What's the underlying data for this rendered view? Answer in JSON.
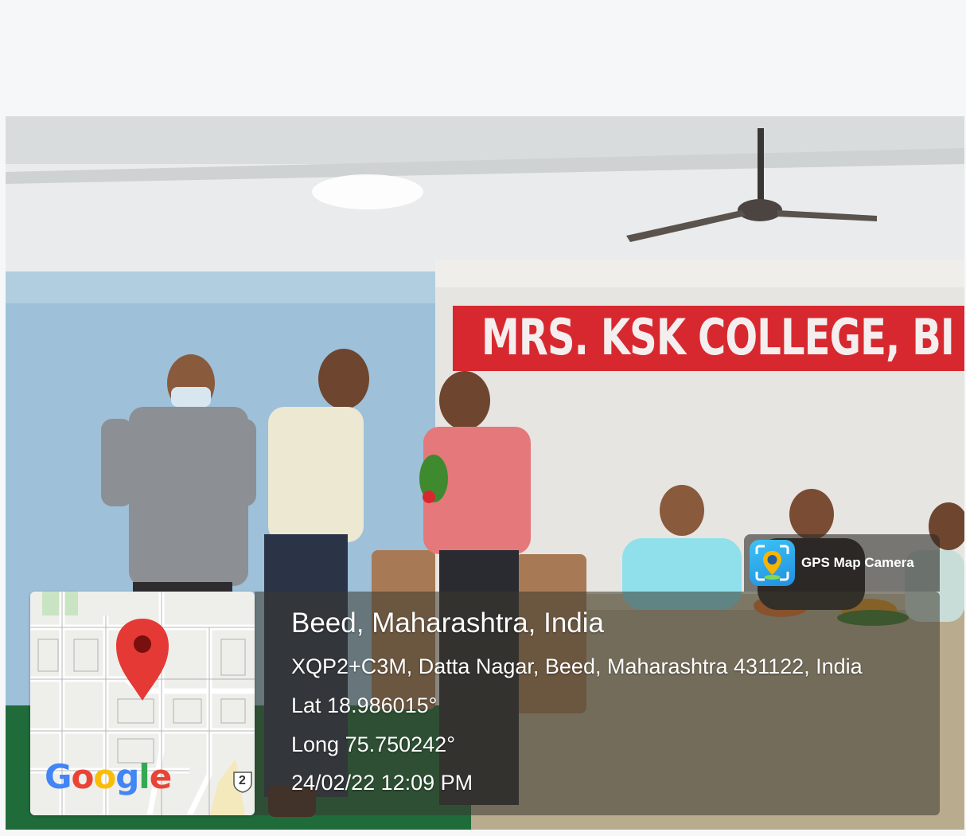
{
  "photo": {
    "banner_text": "MRS. KSK COLLEGE, BI"
  },
  "map": {
    "brand": "Google",
    "road_shield": "2",
    "marker_icon": "map-pin-icon",
    "marker_color": "#e53935"
  },
  "app": {
    "name": "GPS Map Camera",
    "icon": "camera-location-icon"
  },
  "location": {
    "title": "Beed, Maharashtra, India",
    "address": "XQP2+C3M, Datta Nagar, Beed, Maharashtra 431122, India",
    "lat": "Lat 18.986015°",
    "long": "Long 75.750242°",
    "datetime": "24/02/22 12:09 PM"
  },
  "colors": {
    "banner_red": "#d8282f",
    "wall_blue": "#9ec0d8",
    "floor_green": "#1f6b3a"
  }
}
